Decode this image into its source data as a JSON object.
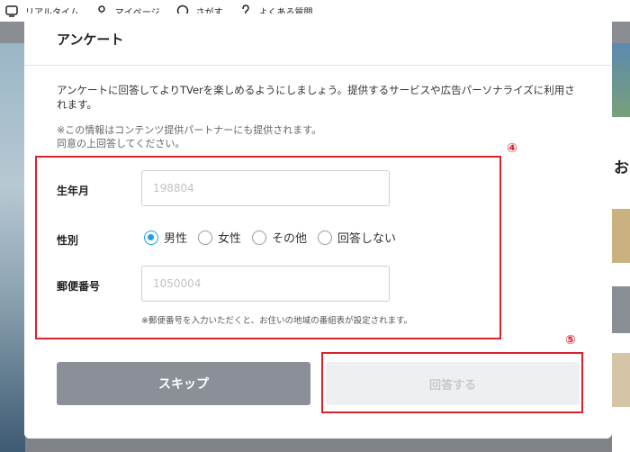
{
  "nav": {
    "items": [
      {
        "label": "リアルタイム",
        "icon": "tv-icon"
      },
      {
        "label": "マイページ",
        "icon": "person-icon"
      },
      {
        "label": "さがす",
        "icon": "search-icon"
      },
      {
        "label": "よくある質問",
        "icon": "question-icon"
      }
    ]
  },
  "background": {
    "right_text": "お"
  },
  "modal": {
    "title": "アンケート",
    "description": "アンケートに回答してよりTVerを楽しめるようにしましょう。提供するサービスや広告パーソナライズに利用されます。",
    "note_line1": "※この情報はコンテンツ提供パートナーにも提供されます。",
    "note_line2": "同意の上回答してください。",
    "birth": {
      "label": "生年月",
      "placeholder": "198804",
      "value": ""
    },
    "gender": {
      "label": "性別",
      "options": [
        "男性",
        "女性",
        "その他",
        "回答しない"
      ],
      "selected": "男性"
    },
    "zip": {
      "label": "郵便番号",
      "placeholder": "1050004",
      "value": "",
      "note": "※郵便番号を入力いただくと、お住いの地域の番組表が設定されます。"
    },
    "skip_label": "スキップ",
    "submit_label": "回答する"
  },
  "annotations": {
    "form_number": "④",
    "submit_number": "⑤",
    "color": "#d8232a"
  }
}
